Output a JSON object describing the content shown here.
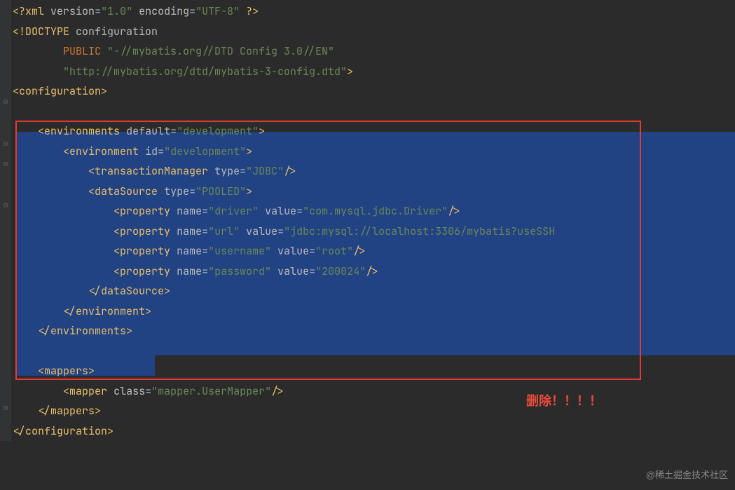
{
  "code": {
    "line1": {
      "prolog_open": "<?",
      "tag": "xml",
      "attr1": "version",
      "val1": "\"1.0\"",
      "attr2": "encoding",
      "val2": "\"UTF-8\"",
      "prolog_close": "?>"
    },
    "line2": {
      "open": "<!DOCTYPE",
      "name": "configuration"
    },
    "line3": {
      "kw": "PUBLIC",
      "val": "\"-//mybatis.org//DTD Config 3.0//EN\""
    },
    "line4": {
      "val": "\"http://mybatis.org/dtd/mybatis-3-config.dtd\"",
      "close": ">"
    },
    "line5": {
      "open": "<",
      "tag": "configuration",
      "close": ">"
    },
    "line6": "",
    "line7": {
      "open": "<",
      "tag": "environments",
      "attr": "default",
      "val": "\"development\"",
      "close": ">"
    },
    "line8": {
      "open": "<",
      "tag": "environment",
      "attr": "id",
      "val": "\"development\"",
      "close": ">"
    },
    "line9": {
      "open": "<",
      "tag": "transactionManager",
      "attr": "type",
      "val": "\"JDBC\"",
      "close": "/>"
    },
    "line10": {
      "open": "<",
      "tag": "dataSource",
      "attr": "type",
      "val": "\"POOLED\"",
      "close": ">"
    },
    "line11": {
      "open": "<",
      "tag": "property",
      "attr1": "name",
      "val1": "\"driver\"",
      "attr2": "value",
      "val2": "\"com.mysql.jdbc.Driver\"",
      "close": "/>"
    },
    "line12": {
      "open": "<",
      "tag": "property",
      "attr1": "name",
      "val1": "\"url\"",
      "attr2": "value",
      "val2": "\"jdbc:mysql://localhost:3306/mybatis?useSSH",
      "close": ""
    },
    "line13": {
      "open": "<",
      "tag": "property",
      "attr1": "name",
      "val1": "\"username\"",
      "attr2": "value",
      "val2": "\"root\"",
      "close": "/>"
    },
    "line14": {
      "open": "<",
      "tag": "property",
      "attr1": "name",
      "val1": "\"password\"",
      "attr2": "value",
      "val2": "\"200024\"",
      "close": "/>"
    },
    "line15": {
      "open": "</",
      "tag": "dataSource",
      "close": ">"
    },
    "line16": {
      "open": "</",
      "tag": "environment",
      "close": ">"
    },
    "line17": {
      "open": "</",
      "tag": "environments",
      "close": ">"
    },
    "line18": "",
    "line19": {
      "open": "<",
      "tag": "mappers",
      "close": ">"
    },
    "line20": {
      "open": "<",
      "tag": "mapper",
      "attr": "class",
      "val": "\"mapper.UserMapper\"",
      "close": "/>"
    },
    "line21": {
      "open": "</",
      "tag": "mappers",
      "close": ">"
    },
    "line22": {
      "open": "</",
      "tag": "configuration",
      "close": ">"
    }
  },
  "annotation": "删除！！！！",
  "watermark": "@稀土掘金技术社区"
}
